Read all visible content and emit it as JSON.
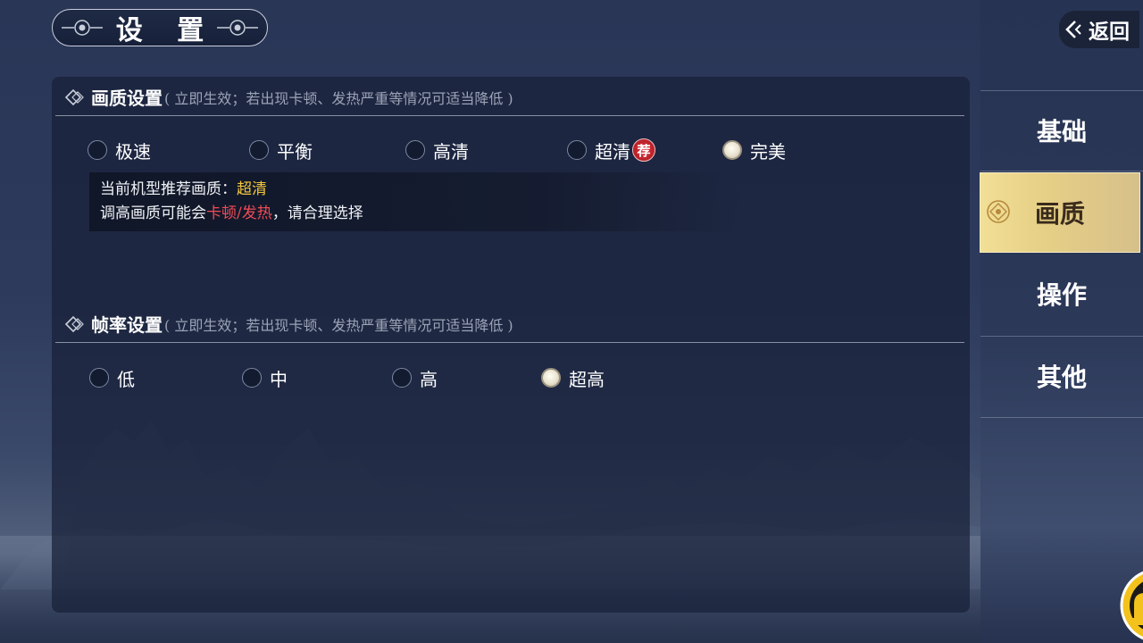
{
  "title": "设 置",
  "back_label": "返回",
  "sections": {
    "quality": {
      "title": "画质设置",
      "note": "( 立即生效；若出现卡顿、发热严重等情况可适当降低 )",
      "options": [
        "极速",
        "平衡",
        "高清",
        "超清",
        "完美"
      ],
      "selected": "完美",
      "recommend_badge": "荐",
      "info_prefix": "当前机型推荐画质：",
      "info_recommended": "超清",
      "warn_prefix": "调高画质可能会",
      "warn_highlight": "卡顿/发热",
      "warn_suffix": "，请合理选择"
    },
    "framerate": {
      "title": "帧率设置",
      "note": "( 立即生效；若出现卡顿、发热严重等情况可适当降低 )",
      "options": [
        "低",
        "中",
        "高",
        "超高"
      ],
      "selected": "超高"
    }
  },
  "sidebar": {
    "items": [
      {
        "label": "基础",
        "active": false
      },
      {
        "label": "画质",
        "active": true
      },
      {
        "label": "操作",
        "active": false
      },
      {
        "label": "其他",
        "active": false
      }
    ]
  },
  "colors": {
    "highlight_yellow": "#f3c63e",
    "highlight_red": "#ef4b55",
    "active_tab_gold": "#e6cf86"
  }
}
